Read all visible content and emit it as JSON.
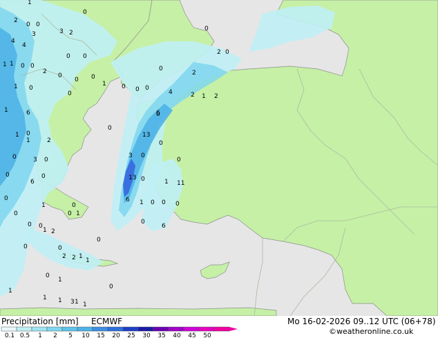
{
  "map": {
    "colors": {
      "sea": "#e6e6e6",
      "land": "#c6f0a6",
      "border": "#a9b9a0",
      "coast": "#8c8c8c",
      "precip_light": "#bfeff5",
      "precip_mid": "#7fd6ee",
      "precip_heavy": "#4fb2e6",
      "precip_max": "#3a6fe0",
      "value_text": "#000000"
    },
    "values": [
      {
        "v": "1"
      },
      {
        "v": "2"
      },
      {
        "v": "0"
      },
      {
        "v": "0"
      },
      {
        "v": "3"
      },
      {
        "v": "2"
      },
      {
        "v": "0"
      },
      {
        "v": "4"
      },
      {
        "v": "4"
      },
      {
        "v": "1"
      },
      {
        "v": "0"
      },
      {
        "v": "0"
      },
      {
        "v": "1"
      },
      {
        "v": "3"
      },
      {
        "v": "0"
      },
      {
        "v": "2"
      },
      {
        "v": "0"
      },
      {
        "v": "0"
      },
      {
        "v": "0"
      },
      {
        "v": "1"
      },
      {
        "v": "0"
      },
      {
        "v": "0"
      },
      {
        "v": "0"
      },
      {
        "v": "1"
      },
      {
        "v": "0"
      },
      {
        "v": "0"
      },
      {
        "v": "0"
      },
      {
        "v": "2"
      },
      {
        "v": "4"
      },
      {
        "v": "2"
      },
      {
        "v": "1"
      },
      {
        "v": "2"
      },
      {
        "v": "1"
      },
      {
        "v": "6"
      },
      {
        "v": "1"
      },
      {
        "v": "0"
      },
      {
        "v": "0"
      },
      {
        "v": "0"
      },
      {
        "v": "6"
      },
      {
        "v": "1"
      },
      {
        "v": "2"
      },
      {
        "v": "0"
      },
      {
        "v": "13"
      },
      {
        "v": "0"
      },
      {
        "v": "3"
      },
      {
        "v": "0"
      },
      {
        "v": "3"
      },
      {
        "v": "0"
      },
      {
        "v": "0"
      },
      {
        "v": "0"
      },
      {
        "v": "6"
      },
      {
        "v": "0"
      },
      {
        "v": "13"
      },
      {
        "v": "0"
      },
      {
        "v": "1"
      },
      {
        "v": "11"
      },
      {
        "v": "0"
      },
      {
        "v": "1"
      },
      {
        "v": "0"
      },
      {
        "v": "6"
      },
      {
        "v": "0"
      },
      {
        "v": "1"
      },
      {
        "v": "0"
      },
      {
        "v": "0"
      },
      {
        "v": "0"
      },
      {
        "v": "0"
      },
      {
        "v": "1"
      },
      {
        "v": "0"
      },
      {
        "v": "0"
      },
      {
        "v": "6"
      },
      {
        "v": "1"
      },
      {
        "v": "2"
      },
      {
        "v": "2"
      },
      {
        "v": "0"
      },
      {
        "v": "0"
      },
      {
        "v": "2"
      },
      {
        "v": "1"
      },
      {
        "v": "0"
      },
      {
        "v": "0"
      },
      {
        "v": "1"
      },
      {
        "v": "0"
      },
      {
        "v": "1"
      },
      {
        "v": "0"
      },
      {
        "v": "1"
      },
      {
        "v": "1"
      },
      {
        "v": "3"
      },
      {
        "v": "1"
      },
      {
        "v": "1"
      },
      {
        "v": "1"
      },
      {
        "v": "0"
      },
      {
        "v": "2"
      },
      {
        "v": "0"
      },
      {
        "v": "0"
      }
    ]
  },
  "footer": {
    "title": "Precipitation [mm]",
    "model": "ECMWF",
    "datetime": "Mo 16-02-2026 09..12 UTC (06+78)",
    "credit": "©weatheronline.co.uk",
    "scale_labels": [
      "0.1",
      "0.5",
      "1",
      "2",
      "5",
      "10",
      "15",
      "20",
      "25",
      "30",
      "35",
      "40",
      "45",
      "50"
    ],
    "scale_colors": [
      "#e8f8fb",
      "#bfeff5",
      "#9fe4f2",
      "#7fd6ee",
      "#5fc3ea",
      "#4fb2e6",
      "#3d8fe3",
      "#2f6fdd",
      "#1f3fc8",
      "#1a1aa8",
      "#6a00b0",
      "#a000c8",
      "#d000d8",
      "#e600c0",
      "#f000a0"
    ]
  }
}
